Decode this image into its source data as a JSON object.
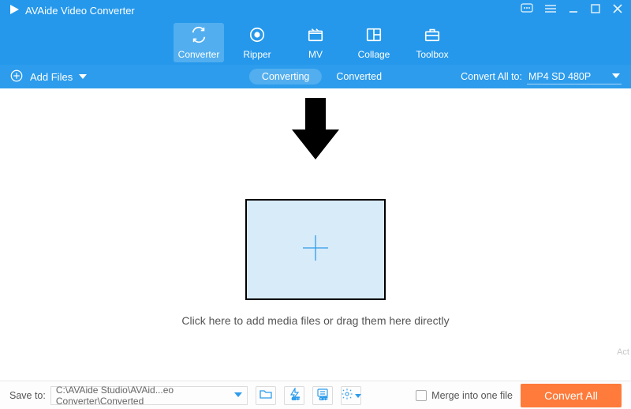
{
  "app": {
    "title": "AVAide Video Converter"
  },
  "nav": {
    "items": [
      {
        "label": "Converter"
      },
      {
        "label": "Ripper"
      },
      {
        "label": "MV"
      },
      {
        "label": "Collage"
      },
      {
        "label": "Toolbox"
      }
    ]
  },
  "subbar": {
    "add_files": "Add Files",
    "tab_converting": "Converting",
    "tab_converted": "Converted",
    "convert_all_to_label": "Convert All to:",
    "format_selected": "MP4 SD 480P"
  },
  "main": {
    "drop_text": "Click here to add media files or drag them here directly"
  },
  "footer": {
    "save_to_label": "Save to:",
    "save_path": "C:\\AVAide Studio\\AVAid...eo Converter\\Converted",
    "merge_label": "Merge into one file",
    "convert_all": "Convert All",
    "watermark": "Act"
  }
}
